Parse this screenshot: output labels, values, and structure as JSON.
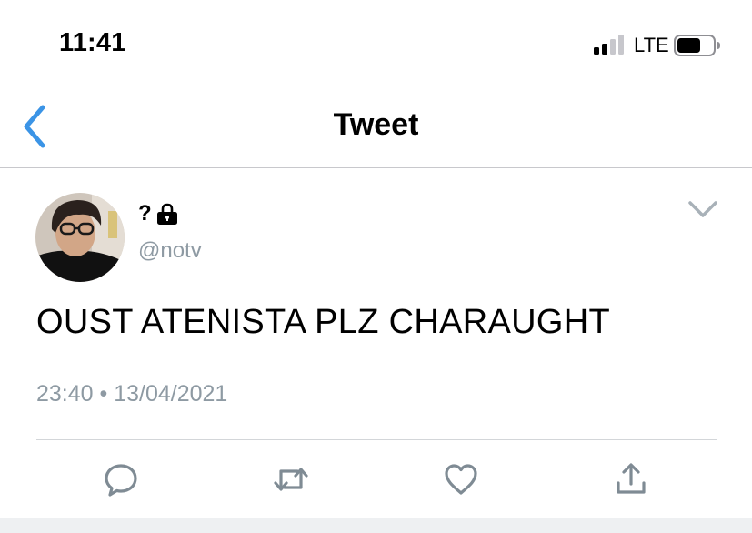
{
  "status_bar": {
    "time": "11:41",
    "network": "LTE"
  },
  "nav": {
    "title": "Tweet"
  },
  "tweet": {
    "display_name": "?",
    "handle": "@notv",
    "text": "OUST ATENISTA PLZ CHARAUGHT",
    "timestamp": "23:40 • 13/04/2021"
  },
  "icons": {
    "back": "chevron-left-icon",
    "lock": "lock-icon",
    "more": "chevron-down-icon",
    "reply": "reply-icon",
    "retweet": "retweet-icon",
    "like": "heart-icon",
    "share": "share-icon"
  },
  "colors": {
    "accent": "#3b94e6",
    "secondary_text": "#8e9aa3",
    "icon_gray": "#7f8b94"
  }
}
